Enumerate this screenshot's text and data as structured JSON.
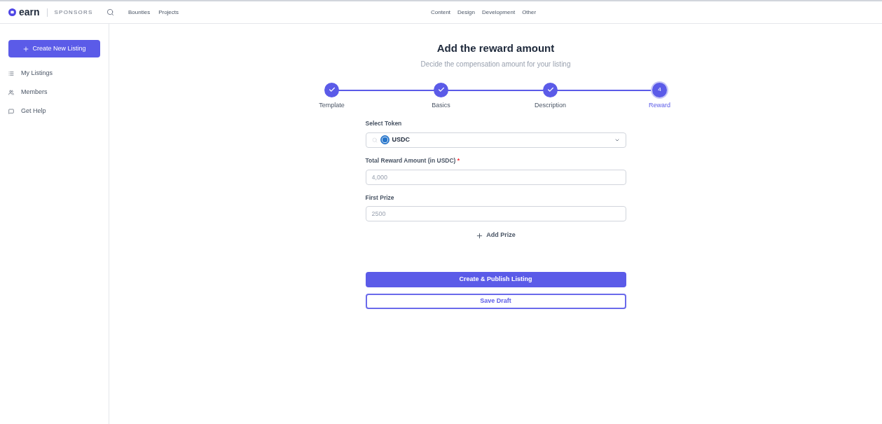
{
  "header": {
    "logo": "earn",
    "brand_sub": "SPONSORS",
    "nav": [
      "Bounties",
      "Projects"
    ],
    "categories": [
      "Content",
      "Design",
      "Development",
      "Other"
    ]
  },
  "sidebar": {
    "create_button": "Create New Listing",
    "items": [
      {
        "label": "My Listings",
        "kind": "list"
      },
      {
        "label": "Members",
        "kind": "members"
      },
      {
        "label": "Get Help",
        "kind": "help"
      }
    ]
  },
  "title": "Add the reward amount",
  "subtitle": "Decide the compensation amount for your listing",
  "steps": [
    {
      "label": "Template",
      "completed": true,
      "selected": false
    },
    {
      "label": "Basics",
      "completed": true,
      "selected": false
    },
    {
      "label": "Description",
      "completed": true,
      "selected": false
    },
    {
      "label": "Reward",
      "number": "4",
      "completed": false,
      "selected": true
    }
  ],
  "token": {
    "label": "Select Token",
    "value": "USDC"
  },
  "fields": [
    {
      "label": "Total Reward Amount (in USDC)",
      "required_mark": "*",
      "placeholder": "4,000"
    },
    {
      "label": "First Prize",
      "placeholder": "2500"
    }
  ],
  "add_prize": "Add Prize",
  "publish_button": "Create & Publish Listing",
  "draft_button": "Save Draft"
}
